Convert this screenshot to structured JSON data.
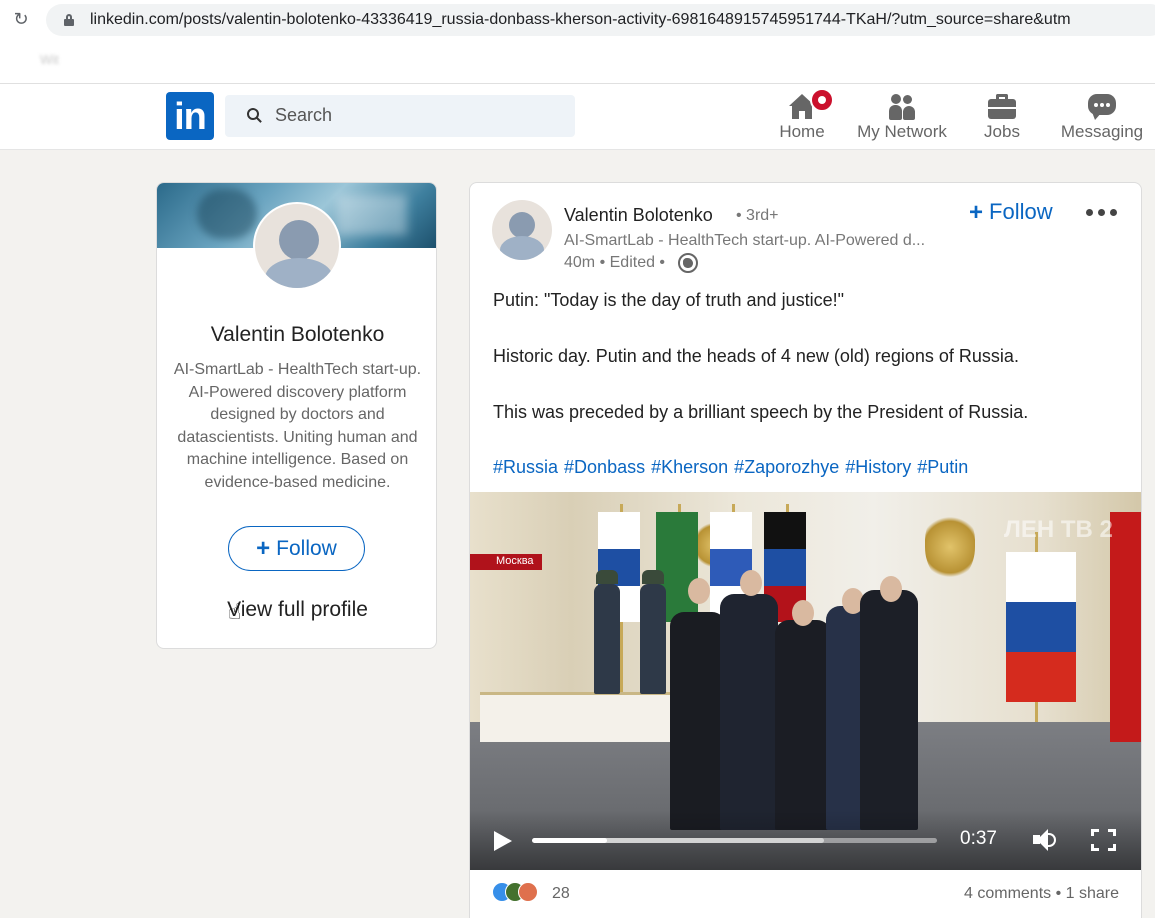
{
  "browser": {
    "url": "linkedin.com/posts/valentin-bolotenko-43336419_russia-donbass-kherson-activity-6981648915745951744-TKaH/?utm_source=share&utm",
    "bookmarks": [
      "Wit",
      "",
      "",
      "",
      "",
      "",
      "",
      ""
    ]
  },
  "header": {
    "logo": "in",
    "search_placeholder": "Search",
    "nav": [
      {
        "label": "Home",
        "icon": "home-icon",
        "has_badge": true
      },
      {
        "label": "My Network",
        "icon": "network-icon"
      },
      {
        "label": "Jobs",
        "icon": "briefcase-icon"
      },
      {
        "label": "Messaging",
        "icon": "messaging-icon"
      }
    ]
  },
  "profile_card": {
    "name": "Valentin Bolotenko",
    "headline": "AI-SmartLab - HealthTech start-up. AI-Powered discovery platform designed by doctors and datascientists. Uniting human and machine intelligence. Based on evidence-based medicine.",
    "follow_label": "Follow",
    "view_profile_label": "View full profile"
  },
  "post": {
    "author": "Valentin Bolotenko",
    "degree": "• 3rd+",
    "author_headline": "AI-SmartLab - HealthTech start-up. AI-Powered d...",
    "meta": "40m • Edited •",
    "follow_label": "Follow",
    "paragraphs": [
      "Putin: \"Today is the day of truth and justice!\"",
      "Historic day. Putin and the heads of 4 new (old) regions of Russia.",
      "This was preceded by a brilliant speech by the President of Russia."
    ],
    "hashtags": [
      "#Russia",
      "#Donbass",
      "#Kherson",
      "#Zaporozhye",
      "#History",
      "#Putin"
    ],
    "video": {
      "location_tag": "Москва",
      "watermark": "ЛЕН ТВ 2",
      "time": "0:37",
      "progress": 0.185,
      "buffered": 0.72
    },
    "reactions_count": "28",
    "comments_share": "4 comments • 1 share"
  },
  "colors": {
    "linkedin_blue": "#0a66c2",
    "notification_red": "#cb112d",
    "page_bg": "#f3f2ef"
  }
}
